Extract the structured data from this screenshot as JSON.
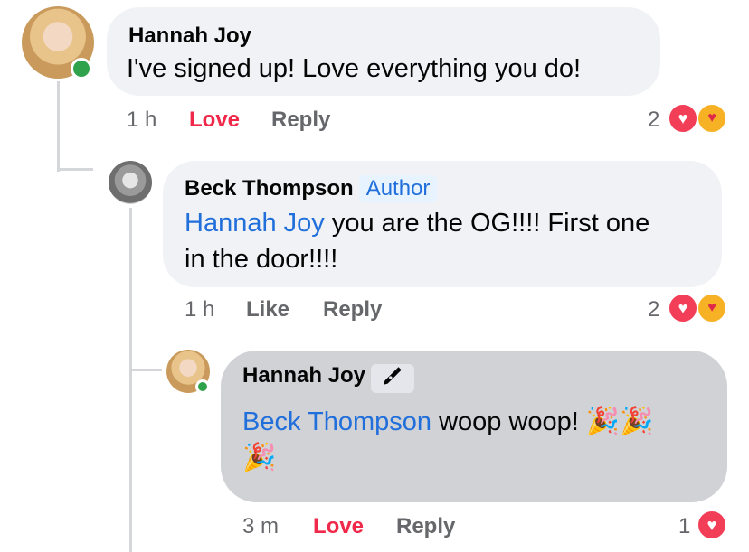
{
  "comments": [
    {
      "author": "Hannah Joy",
      "text": "I've signed up! Love everything you do!",
      "time": "1 h",
      "reaction_action": "Love",
      "reply_label": "Reply",
      "reaction_count": "2"
    },
    {
      "author": "Beck Thompson",
      "badge": "Author",
      "mention": "Hannah Joy",
      "text_line1": " you are the OG!!!! First one",
      "text_line2": "in the door!!!!",
      "time": "1 h",
      "reaction_action": "Like",
      "reply_label": "Reply",
      "reaction_count": "2"
    },
    {
      "author": "Hannah Joy",
      "mention": "Beck Thompson",
      "text": " woop woop! ",
      "time": "3 m",
      "reaction_action": "Love",
      "reply_label": "Reply",
      "reaction_count": "1"
    }
  ],
  "icons": {
    "heart": "heart-icon",
    "care": "care-icon",
    "pen": "pen-nib-icon",
    "party": "party-popper-icon"
  },
  "colors": {
    "love": "#f02849",
    "mention": "#216fdb",
    "online": "#31a24c"
  }
}
